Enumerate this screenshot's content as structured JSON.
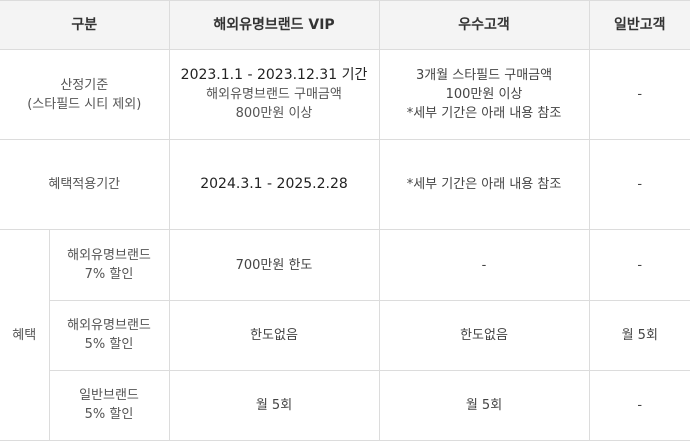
{
  "header": {
    "col1": "구분",
    "col2": "해외유명브랜드 VIP",
    "col3": "우수고객",
    "col4": "일반고객"
  },
  "rows": {
    "criteria": {
      "label_line1": "산정기준",
      "label_line2": "(스타필드 시티 제외)",
      "vip_line1": "2023.1.1 - 2023.12.31 기간",
      "vip_line2": "해외유명브랜드 구매금액",
      "vip_line3": "800만원 이상",
      "excellent_line1": "3개월 스타필드 구매금액",
      "excellent_line2": "100만원 이상",
      "excellent_line3": "*세부 기간은 아래 내용 참조",
      "general": "-"
    },
    "period": {
      "label": "혜택적용기간",
      "vip": "2024.3.1 - 2025.2.28",
      "excellent": "*세부 기간은 아래 내용 참조",
      "general": "-"
    },
    "benefit_label": "혜택",
    "benefit_rows": [
      {
        "sub_line1": "해외유명브랜드",
        "sub_line2": "7% 할인",
        "vip": "700만원 한도",
        "excellent": "-",
        "general": "-"
      },
      {
        "sub_line1": "해외유명브랜드",
        "sub_line2": "5% 할인",
        "vip": "한도없음",
        "excellent": "한도없음",
        "general": "월 5회"
      },
      {
        "sub_line1": "일반브랜드",
        "sub_line2": "5% 할인",
        "vip": "월 5회",
        "excellent": "월 5회",
        "general": "-"
      }
    ]
  }
}
